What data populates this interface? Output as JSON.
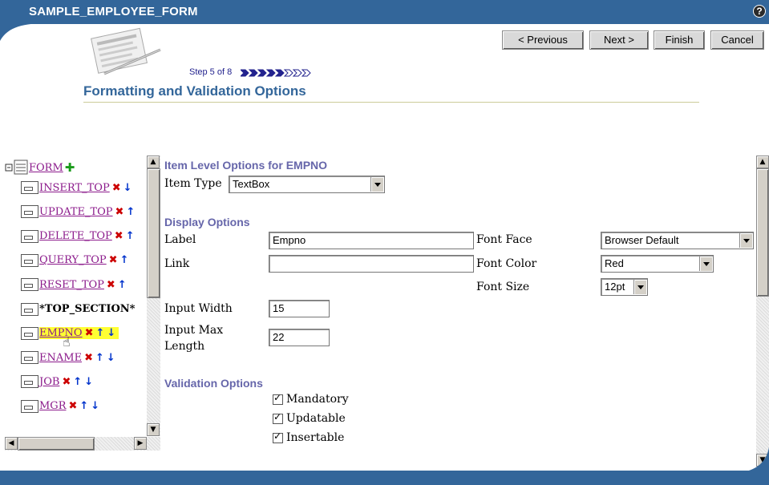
{
  "window": {
    "title": "SAMPLE_EMPLOYEE_FORM",
    "help_glyph": "?"
  },
  "nav": {
    "previous": "< Previous",
    "next": "Next >",
    "finish": "Finish",
    "cancel": "Cancel"
  },
  "wizard": {
    "step_text": "Step 5 of 8",
    "steps_total": 8,
    "steps_done": 5,
    "page_title": "Formatting and Validation Options"
  },
  "tree": {
    "root_label": "FORM",
    "items": [
      {
        "label": "INSERT_TOP",
        "link": true,
        "delete": true,
        "up": false,
        "down": true
      },
      {
        "label": "UPDATE_TOP",
        "link": true,
        "delete": true,
        "up": true,
        "down": false
      },
      {
        "label": "DELETE_TOP",
        "link": true,
        "delete": true,
        "up": true,
        "down": false
      },
      {
        "label": "QUERY_TOP",
        "link": true,
        "delete": true,
        "up": true,
        "down": false
      },
      {
        "label": "RESET_TOP",
        "link": true,
        "delete": true,
        "up": true,
        "down": false
      },
      {
        "label": "*TOP_SECTION*",
        "link": false,
        "delete": false,
        "up": false,
        "down": false
      },
      {
        "label": "EMPNO",
        "link": true,
        "delete": true,
        "up": true,
        "down": true,
        "selected": true
      },
      {
        "label": "ENAME",
        "link": true,
        "delete": true,
        "up": true,
        "down": true
      },
      {
        "label": "JOB",
        "link": true,
        "delete": true,
        "up": true,
        "down": true
      },
      {
        "label": "MGR",
        "link": true,
        "delete": true,
        "up": true,
        "down": true
      }
    ]
  },
  "item_options": {
    "heading": "Item Level Options for EMPNO",
    "item_type_label": "Item Type",
    "item_type_value": "TextBox"
  },
  "display_options": {
    "heading": "Display Options",
    "label_label": "Label",
    "label_value": "Empno",
    "link_label": "Link",
    "link_value": "",
    "font_face_label": "Font Face",
    "font_face_value": "Browser Default",
    "font_color_label": "Font Color",
    "font_color_value": "Red",
    "font_size_label": "Font Size",
    "font_size_value": "12pt",
    "input_width_label": "Input Width",
    "input_width_value": "15",
    "input_max_length_label": "Input Max Length",
    "input_max_length_value": "22"
  },
  "validation_options": {
    "heading": "Validation Options",
    "mandatory_label": "Mandatory",
    "mandatory_checked": true,
    "updatable_label": "Updatable",
    "updatable_checked": true,
    "insertable_label": "Insertable",
    "insertable_checked": true
  },
  "colors": {
    "brand_blue": "#33669a",
    "section_heading": "#6666aa",
    "link_purple": "#8b1a8b",
    "highlight_yellow": "#ffff33",
    "delete_red": "#cc0000",
    "arrow_blue": "#0033cc",
    "add_green": "#1a9a1a"
  }
}
